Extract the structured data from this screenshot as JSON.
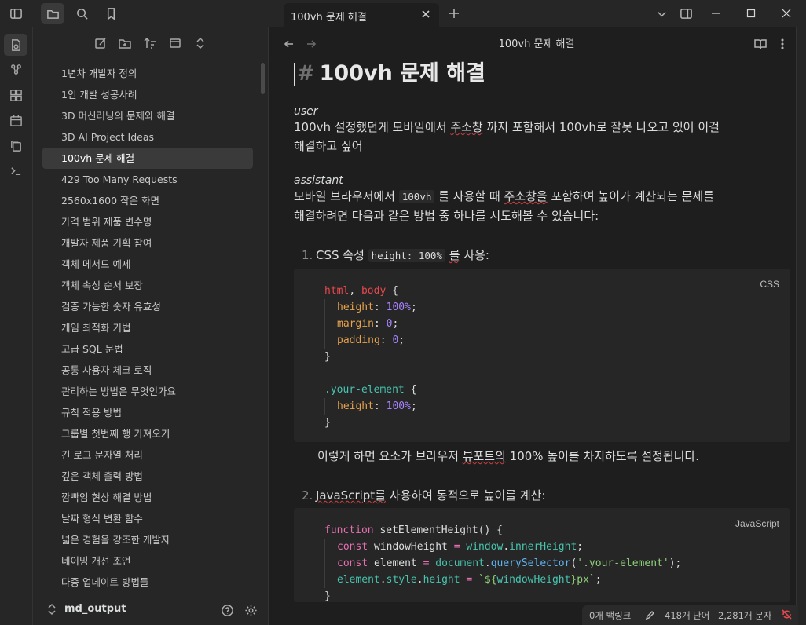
{
  "tab": {
    "title": "100vh 문제 해결"
  },
  "header": {
    "title": "100vh 문제 해결"
  },
  "sidebar": {
    "files": [
      "1년차 개발자 정의",
      "1인 개발 성공사례",
      "3D 머신러닝의 문제와 해결",
      "3D AI Project Ideas",
      "100vh 문제 해결",
      "429 Too Many Requests",
      "2560x1600 작은 화면",
      "가격 범위 제품 변수명",
      "개발자 제품 기획 참여",
      "객체 메서드 예제",
      "객체 속성 순서 보장",
      "검증 가능한 숫자 유효성",
      "게임 최적화 기법",
      "고급 SQL 문법",
      "공통 사용자 체크 로직",
      "관리하는 방법은 무엇인가요",
      "규칙 적용 방법",
      "그룹별 첫번째 행 가져오기",
      "긴 로그 문자열 처리",
      "깊은 객체 출력 방법",
      "깜빡임 현상 해결 방법",
      "날짜 형식 변환 함수",
      "넓은 경험을 강조한 개발자",
      "네이밍 개선 조언",
      "다중 업데이트 방법들"
    ],
    "active_index": 4,
    "vault_name": "md_output"
  },
  "doc": {
    "h1_hash": "#",
    "h1": "100vh 문제 해결",
    "user_role": "user",
    "user_p1": "100vh 설정했던게 모바일에서 ",
    "user_sq1": "주소창",
    "user_p2": " 까지 포함해서 100vh로 잘못 나오고 있어 이걸",
    "user_p3": "해결하고 싶어",
    "assistant_role": "assistant",
    "a_p1": "모바일 브라우저에서 ",
    "a_code1": "100vh",
    "a_p2": " 를 사용할 때 ",
    "a_sq1": "주소창을",
    "a_p3": " 포함하여 높이가 계산되는 문제를",
    "a_p4": "해결하려면 다음과 같은 방법 중 하나를 시도해볼 수 있습니다:",
    "li1_num": "1.",
    "li1_a": "CSS 속성 ",
    "li1_code": "height: 100%",
    "li1_b": " ",
    "li1_sq": "를",
    "li1_c": " 사용:",
    "css_lang": "CSS",
    "css_lines": {
      "l1a": "html",
      "l1b": ", ",
      "l1c": "body",
      "l1d": " {",
      "l2a": "height",
      "l2b": ": ",
      "l2c": "100%",
      "l2d": ";",
      "l3a": "margin",
      "l3b": ": ",
      "l3c": "0",
      "l3d": ";",
      "l4a": "padding",
      "l4b": ": ",
      "l4c": "0",
      "l4d": ";",
      "l5": "}",
      "l7a": ".your-element",
      "l7b": " {",
      "l8a": "height",
      "l8b": ": ",
      "l8c": "100%",
      "l8d": ";",
      "l9": "}"
    },
    "after1_a": "이렇게 하면 요소가 브라우저 ",
    "after1_sq": "뷰포트의",
    "after1_b": " 100% 높이를 차지하도록 설정됩니다.",
    "li2_num": "2.",
    "li2_sq": "JavaScript를",
    "li2_b": " 사용하여 동적으로 높이를 계산:",
    "js_lang": "JavaScript",
    "js_lines": {
      "l1a": "function",
      "l1b": " setElementHeight",
      "l1c": "() {",
      "l2a": "const",
      "l2b": " windowHeight ",
      "l2c": "=",
      "l2d": " window",
      "l2e": ".",
      "l2f": "innerHeight",
      "l2g": ";",
      "l3a": "const",
      "l3b": " element ",
      "l3c": "=",
      "l3d": " document",
      "l3e": ".",
      "l3f": "querySelector",
      "l3g": "(",
      "l3h": "'.your-element'",
      "l3i": ");",
      "l4a": "element",
      "l4b": ".",
      "l4c": "style",
      "l4d": ".",
      "l4e": "height",
      "l4f": " = ",
      "l4g": "`${",
      "l4h": "windowHeight",
      "l4i": "}px`",
      "l4j": ";",
      "l5": "}"
    }
  },
  "status": {
    "backlinks": "0개 백링크",
    "words": "418개 단어",
    "chars": "2,281개 문자"
  },
  "colors": {
    "accent_red": "#e5484d",
    "keyword_purple": "#a882ff"
  }
}
